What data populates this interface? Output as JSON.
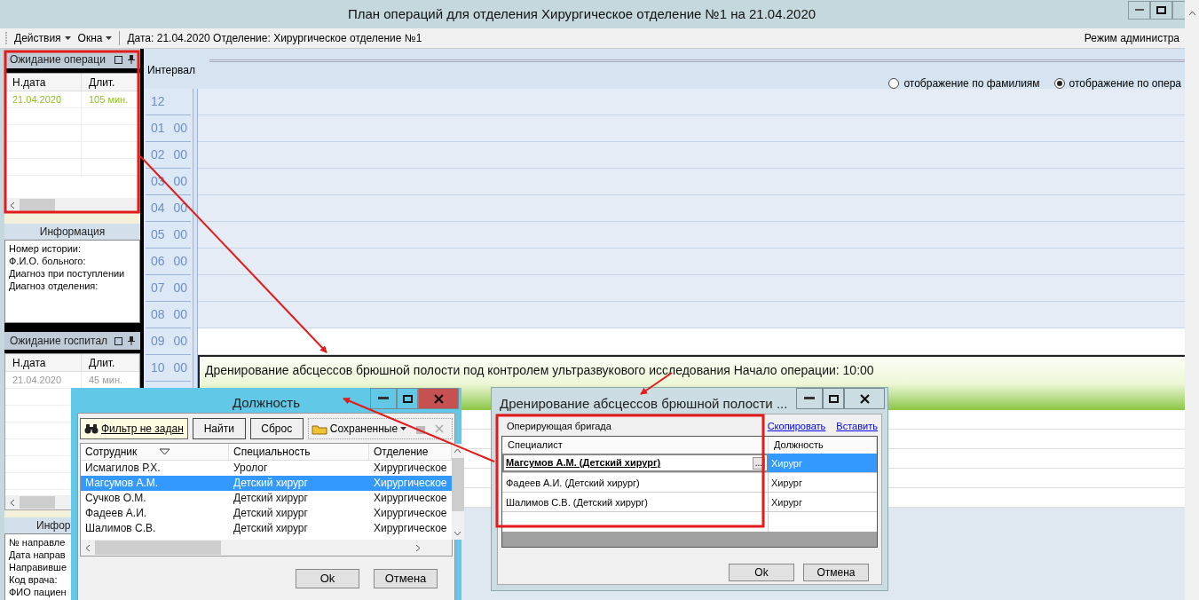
{
  "window": {
    "title": "План операций для отделения Хирургическое отделение №1 на 21.04.2020"
  },
  "toolbar": {
    "menus": [
      "Действия",
      "Окна"
    ],
    "info": "Дата: 21.04.2020 Отделение: Хирургическое отделение №1",
    "mode": "Режим администра"
  },
  "waiting_operations": {
    "title": "Ожидание операци",
    "columns": [
      "Н.дата",
      "Длит."
    ],
    "rows": [
      {
        "cells": [
          "21.04.2020",
          "105 мин."
        ],
        "color": "#8fc31f"
      }
    ]
  },
  "info": {
    "title": "Информация",
    "lines": [
      "Номер истории:",
      "Ф.И.О. больного:",
      "Диагноз при поступлении",
      "Диагноз отделения:"
    ]
  },
  "waiting_hospital": {
    "title": "Ожидание госпитал",
    "columns": [
      "Н.дата",
      "Длит."
    ],
    "rows": [
      {
        "cells": [
          "21.04.2020",
          "45 мин."
        ],
        "color": "#9a9a9a"
      }
    ]
  },
  "referral_info": {
    "title": "Инфор",
    "lines": [
      "№ направле",
      "Дата направ",
      "Направивше",
      "Код врача:",
      "ФИО пациен"
    ]
  },
  "schedule": {
    "interval_label": "Интервал",
    "view_options": [
      {
        "label": "отображение по фамилиям",
        "selected": false
      },
      {
        "label": "отображение по опера",
        "selected": true
      }
    ],
    "hours": [
      {
        "h": "12"
      },
      {
        "h": "01",
        "m": "00"
      },
      {
        "h": "02",
        "m": "00"
      },
      {
        "h": "03",
        "m": "00"
      },
      {
        "h": "04",
        "m": "00"
      },
      {
        "h": "05",
        "m": "00"
      },
      {
        "h": "06",
        "m": "00"
      },
      {
        "h": "07",
        "m": "00"
      },
      {
        "h": "08",
        "m": "00"
      },
      {
        "h": "09",
        "m": "00"
      },
      {
        "h": "10",
        "m": "00"
      }
    ],
    "operation": "Дренирование абсцессов брюшной полости под контролем ультразвукового исследования Начало операции: 10:00"
  },
  "position_dialog": {
    "title": "Должность",
    "filter_link": "Фильтр не задан",
    "buttons": [
      "Найти",
      "Сброс"
    ],
    "saved": "Сохраненные",
    "columns": [
      "Сотрудник",
      "Специальность",
      "Отделение"
    ],
    "rows": [
      {
        "cells": [
          "Исмагилов Р.Х.",
          "Уролог",
          "Хирургическое"
        ],
        "selected": false
      },
      {
        "cells": [
          "Магсумов А.М.",
          "Детский хирург",
          "Хирургическое"
        ],
        "selected": true
      },
      {
        "cells": [
          "Сучков О.М.",
          "Детский хирург",
          "Хирургическое"
        ],
        "selected": false
      },
      {
        "cells": [
          "Фадеев А.И.",
          "Детский хирург",
          "Хирургическое"
        ],
        "selected": false
      },
      {
        "cells": [
          "Шалимов С.В.",
          "Детский хирург",
          "Хирургическое"
        ],
        "selected": false
      }
    ],
    "actions": [
      "Ok",
      "Отмена"
    ]
  },
  "team_dialog": {
    "title": "Дренирование абсцессов брюшной полости ...",
    "section": "Оперирующая бригада",
    "links": [
      "Скопировать",
      "Вставить"
    ],
    "columns": [
      "Специалист",
      "Должность"
    ],
    "browse_button": "...",
    "rows": [
      {
        "specialist": "Магсумов А.М. (Детский хирург)",
        "position": "Хирург",
        "editing": true,
        "selected": true
      },
      {
        "specialist": "Фадеев А.И. (Детский хирург)",
        "position": "Хирург",
        "editing": false,
        "selected": false
      },
      {
        "specialist": "Шалимов С.В. (Детский хирург)",
        "position": "Хирург",
        "editing": false,
        "selected": false
      }
    ],
    "actions": [
      "Ok",
      "Отмена"
    ]
  }
}
